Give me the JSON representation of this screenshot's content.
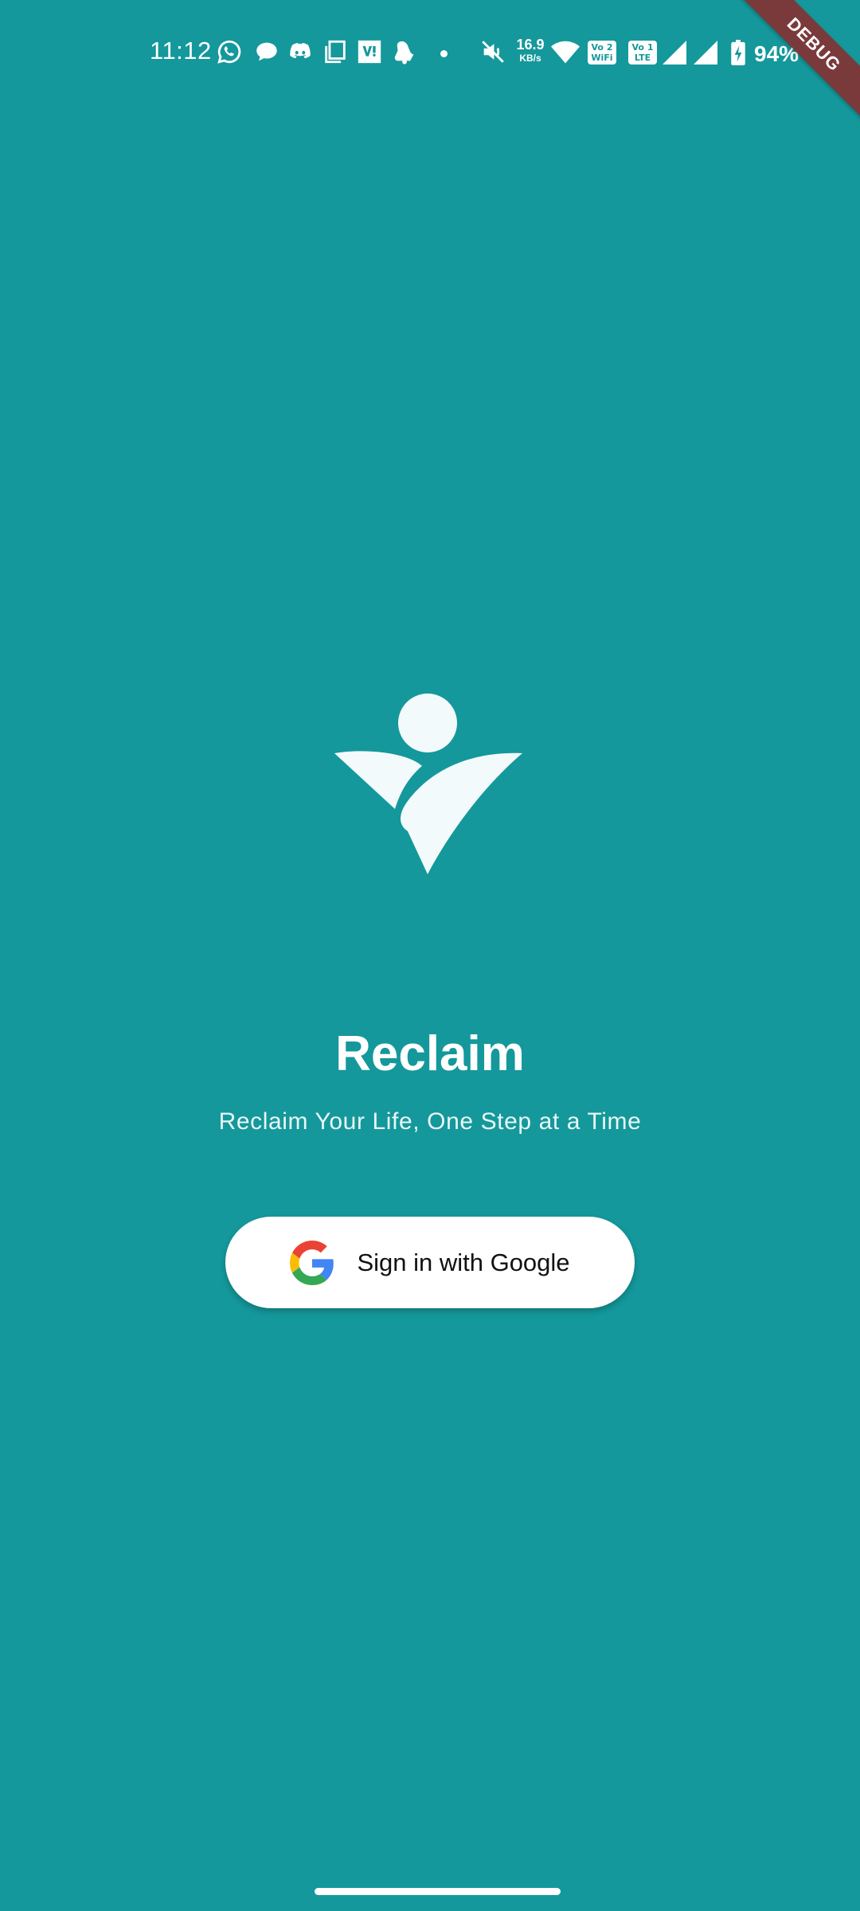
{
  "status_bar": {
    "time": "11:12",
    "network_speed_value": "16.9",
    "network_speed_unit": "KB/s",
    "sim_vowifi_label": "Vo 2 WiFi",
    "sim_volte_label": "Vo 1 LTE",
    "battery_percent": "94%",
    "icons": [
      "whatsapp-icon",
      "chat-bubble-icon",
      "discord-icon",
      "copy-icon",
      "vi-icon",
      "notification-bell-icon",
      "dot-icon",
      "mute-icon",
      "wifi-icon",
      "signal-icon",
      "signal-icon",
      "battery-charging-icon"
    ]
  },
  "debug_banner": "DEBUG",
  "app": {
    "title": "Reclaim",
    "tagline": "Reclaim Your Life, One Step at a Time",
    "logo": "person-leaf-logo"
  },
  "auth": {
    "google_button_label": "Sign in with Google",
    "google_icon": "google-g-icon"
  },
  "colors": {
    "background": "#14989B",
    "debug_ribbon": "#7A3A3B",
    "button_background": "#FFFFFF",
    "button_text": "#111111"
  }
}
